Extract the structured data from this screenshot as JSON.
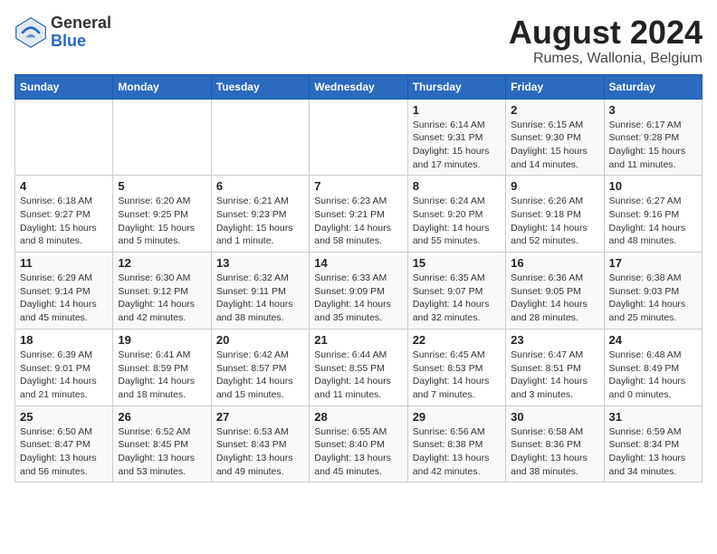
{
  "header": {
    "logo_line1": "General",
    "logo_line2": "Blue",
    "month_year": "August 2024",
    "location": "Rumes, Wallonia, Belgium"
  },
  "weekdays": [
    "Sunday",
    "Monday",
    "Tuesday",
    "Wednesday",
    "Thursday",
    "Friday",
    "Saturday"
  ],
  "weeks": [
    [
      {
        "day": "",
        "info": ""
      },
      {
        "day": "",
        "info": ""
      },
      {
        "day": "",
        "info": ""
      },
      {
        "day": "",
        "info": ""
      },
      {
        "day": "1",
        "info": "Sunrise: 6:14 AM\nSunset: 9:31 PM\nDaylight: 15 hours\nand 17 minutes."
      },
      {
        "day": "2",
        "info": "Sunrise: 6:15 AM\nSunset: 9:30 PM\nDaylight: 15 hours\nand 14 minutes."
      },
      {
        "day": "3",
        "info": "Sunrise: 6:17 AM\nSunset: 9:28 PM\nDaylight: 15 hours\nand 11 minutes."
      }
    ],
    [
      {
        "day": "4",
        "info": "Sunrise: 6:18 AM\nSunset: 9:27 PM\nDaylight: 15 hours\nand 8 minutes."
      },
      {
        "day": "5",
        "info": "Sunrise: 6:20 AM\nSunset: 9:25 PM\nDaylight: 15 hours\nand 5 minutes."
      },
      {
        "day": "6",
        "info": "Sunrise: 6:21 AM\nSunset: 9:23 PM\nDaylight: 15 hours\nand 1 minute."
      },
      {
        "day": "7",
        "info": "Sunrise: 6:23 AM\nSunset: 9:21 PM\nDaylight: 14 hours\nand 58 minutes."
      },
      {
        "day": "8",
        "info": "Sunrise: 6:24 AM\nSunset: 9:20 PM\nDaylight: 14 hours\nand 55 minutes."
      },
      {
        "day": "9",
        "info": "Sunrise: 6:26 AM\nSunset: 9:18 PM\nDaylight: 14 hours\nand 52 minutes."
      },
      {
        "day": "10",
        "info": "Sunrise: 6:27 AM\nSunset: 9:16 PM\nDaylight: 14 hours\nand 48 minutes."
      }
    ],
    [
      {
        "day": "11",
        "info": "Sunrise: 6:29 AM\nSunset: 9:14 PM\nDaylight: 14 hours\nand 45 minutes."
      },
      {
        "day": "12",
        "info": "Sunrise: 6:30 AM\nSunset: 9:12 PM\nDaylight: 14 hours\nand 42 minutes."
      },
      {
        "day": "13",
        "info": "Sunrise: 6:32 AM\nSunset: 9:11 PM\nDaylight: 14 hours\nand 38 minutes."
      },
      {
        "day": "14",
        "info": "Sunrise: 6:33 AM\nSunset: 9:09 PM\nDaylight: 14 hours\nand 35 minutes."
      },
      {
        "day": "15",
        "info": "Sunrise: 6:35 AM\nSunset: 9:07 PM\nDaylight: 14 hours\nand 32 minutes."
      },
      {
        "day": "16",
        "info": "Sunrise: 6:36 AM\nSunset: 9:05 PM\nDaylight: 14 hours\nand 28 minutes."
      },
      {
        "day": "17",
        "info": "Sunrise: 6:38 AM\nSunset: 9:03 PM\nDaylight: 14 hours\nand 25 minutes."
      }
    ],
    [
      {
        "day": "18",
        "info": "Sunrise: 6:39 AM\nSunset: 9:01 PM\nDaylight: 14 hours\nand 21 minutes."
      },
      {
        "day": "19",
        "info": "Sunrise: 6:41 AM\nSunset: 8:59 PM\nDaylight: 14 hours\nand 18 minutes."
      },
      {
        "day": "20",
        "info": "Sunrise: 6:42 AM\nSunset: 8:57 PM\nDaylight: 14 hours\nand 15 minutes."
      },
      {
        "day": "21",
        "info": "Sunrise: 6:44 AM\nSunset: 8:55 PM\nDaylight: 14 hours\nand 11 minutes."
      },
      {
        "day": "22",
        "info": "Sunrise: 6:45 AM\nSunset: 8:53 PM\nDaylight: 14 hours\nand 7 minutes."
      },
      {
        "day": "23",
        "info": "Sunrise: 6:47 AM\nSunset: 8:51 PM\nDaylight: 14 hours\nand 3 minutes."
      },
      {
        "day": "24",
        "info": "Sunrise: 6:48 AM\nSunset: 8:49 PM\nDaylight: 14 hours\nand 0 minutes."
      }
    ],
    [
      {
        "day": "25",
        "info": "Sunrise: 6:50 AM\nSunset: 8:47 PM\nDaylight: 13 hours\nand 56 minutes."
      },
      {
        "day": "26",
        "info": "Sunrise: 6:52 AM\nSunset: 8:45 PM\nDaylight: 13 hours\nand 53 minutes."
      },
      {
        "day": "27",
        "info": "Sunrise: 6:53 AM\nSunset: 8:43 PM\nDaylight: 13 hours\nand 49 minutes."
      },
      {
        "day": "28",
        "info": "Sunrise: 6:55 AM\nSunset: 8:40 PM\nDaylight: 13 hours\nand 45 minutes."
      },
      {
        "day": "29",
        "info": "Sunrise: 6:56 AM\nSunset: 8:38 PM\nDaylight: 13 hours\nand 42 minutes."
      },
      {
        "day": "30",
        "info": "Sunrise: 6:58 AM\nSunset: 8:36 PM\nDaylight: 13 hours\nand 38 minutes."
      },
      {
        "day": "31",
        "info": "Sunrise: 6:59 AM\nSunset: 8:34 PM\nDaylight: 13 hours\nand 34 minutes."
      }
    ]
  ]
}
